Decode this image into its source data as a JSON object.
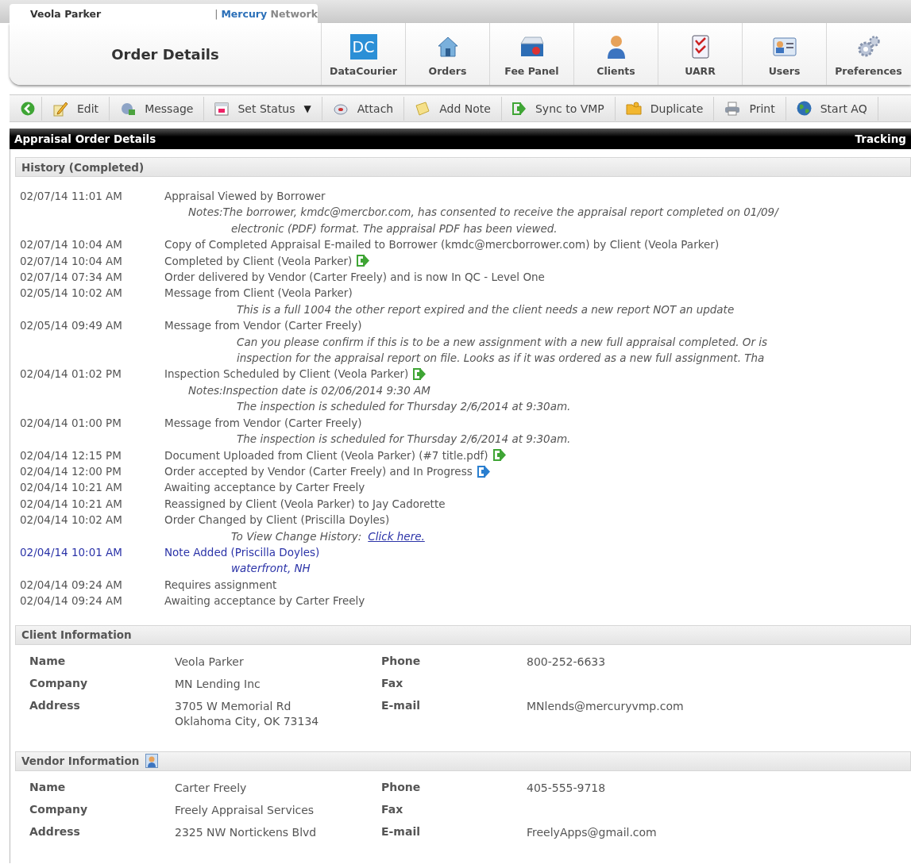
{
  "header": {
    "user_tab": "Veola Parker",
    "separator": "|",
    "brand_first": "Mercury",
    "brand_second": "Network",
    "title": "Order Details",
    "tiles": [
      {
        "label": "DataCourier",
        "icon_text": "DC"
      },
      {
        "label": "Orders"
      },
      {
        "label": "Fee Panel"
      },
      {
        "label": "Clients"
      },
      {
        "label": "UARR"
      },
      {
        "label": "Users"
      },
      {
        "label": "Preferences"
      }
    ]
  },
  "toolbar": [
    {
      "kind": "icon"
    },
    {
      "kind": "labeled",
      "label": "Edit"
    },
    {
      "kind": "labeled",
      "label": "Message"
    },
    {
      "kind": "labeled",
      "label": "Set Status",
      "caret": "▼"
    },
    {
      "kind": "labeled",
      "label": "Attach"
    },
    {
      "kind": "labeled",
      "label": "Add Note"
    },
    {
      "kind": "labeled",
      "label": "Sync to VMP"
    },
    {
      "kind": "labeled",
      "label": "Duplicate"
    },
    {
      "kind": "labeled",
      "label": "Print"
    },
    {
      "kind": "labeled",
      "label": "Start AQ"
    }
  ],
  "section_bar": {
    "title": "Appraisal Order Details",
    "right": "Tracking"
  },
  "history": {
    "title": "History (Completed)",
    "entries": [
      {
        "time": "02/07/14 11:01 AM",
        "text": "Appraisal Viewed by Borrower",
        "highlighted": false,
        "notes": [
          {
            "kind": "notes",
            "text": "Notes:The borrower, kmdc@mercbor.com, has consented to receive the appraisal report completed on 01/09/"
          },
          {
            "kind": "detail",
            "text": "electronic (PDF) format. The appraisal PDF has been viewed."
          }
        ]
      },
      {
        "time": "02/07/14 10:04 AM",
        "text": "Copy of Completed Appraisal E-mailed to Borrower (kmdc@mercborrower.com) by Client (Veola Parker)",
        "highlighted": false
      },
      {
        "time": "02/07/14 10:04 AM",
        "text": "Completed by Client (Veola Parker)",
        "action_icon": {
          "color": "#3fa535"
        },
        "highlighted": false
      },
      {
        "time": "02/07/14 07:34 AM",
        "text": "Order delivered by Vendor (Carter Freely) and is now In QC - Level One",
        "highlighted": false
      },
      {
        "time": "02/05/14 10:02 AM",
        "text": "Message from Client (Veola Parker)",
        "highlighted": false,
        "notes": [
          {
            "kind": "message",
            "text": "This is a full 1004 the other report expired and the client needs a new report NOT an update"
          }
        ]
      },
      {
        "time": "02/05/14 09:49 AM",
        "text": "Message from Vendor (Carter Freely)",
        "highlighted": false,
        "notes": [
          {
            "kind": "message",
            "text": "Can you please confirm if this is to be a new assignment with a new full appraisal completed. Or is"
          },
          {
            "kind": "message",
            "text": "inspection for the appraisal report on file. Looks as if it was ordered as a new full assignment. Tha"
          }
        ]
      },
      {
        "time": "02/04/14 01:02 PM",
        "text": "Inspection Scheduled by Client (Veola Parker)",
        "action_icon": {
          "color": "#3fa535"
        },
        "highlighted": false,
        "notes": [
          {
            "kind": "notes",
            "text": "Notes:Inspection date is 02/06/2014 9:30 AM"
          },
          {
            "kind": "message",
            "text": "The inspection is scheduled for Thursday 2/6/2014 at 9:30am."
          }
        ]
      },
      {
        "time": "02/04/14 01:00 PM",
        "text": "Message from Vendor (Carter Freely)",
        "highlighted": false,
        "notes": [
          {
            "kind": "message",
            "text": "The inspection is scheduled for Thursday 2/6/2014 at 9:30am."
          }
        ]
      },
      {
        "time": "02/04/14 12:15 PM",
        "text": "Document Uploaded from Client (Veola Parker) (#7 title.pdf)",
        "action_icon": {
          "color": "#3fa535"
        },
        "highlighted": false
      },
      {
        "time": "02/04/14 12:00 PM",
        "text": "Order accepted by Vendor (Carter Freely) and In Progress",
        "action_icon": {
          "color": "#2a7fd0"
        },
        "highlighted": false
      },
      {
        "time": "02/04/14 10:21 AM",
        "text": "Awaiting acceptance by Carter Freely",
        "highlighted": false
      },
      {
        "time": "02/04/14 10:21 AM",
        "text": "Reassigned by Client (Veola Parker) to Jay Cadorette",
        "highlighted": false
      },
      {
        "time": "02/04/14 10:02 AM",
        "text": "Order Changed by Client (Priscilla Doyles)",
        "highlighted": false,
        "notes": [
          {
            "kind": "detail",
            "text": "To View Change History:",
            "link": "Click here."
          }
        ]
      },
      {
        "time": "02/04/14 10:01 AM",
        "text": "Note Added (Priscilla Doyles)",
        "highlighted": true,
        "notes": [
          {
            "kind": "detail",
            "text": "waterfront, NH"
          }
        ]
      },
      {
        "time": "02/04/14 09:24 AM",
        "text": "Requires assignment",
        "highlighted": false
      },
      {
        "time": "02/04/14 09:24 AM",
        "text": "Awaiting acceptance by Carter Freely",
        "highlighted": false
      }
    ]
  },
  "client_info": {
    "title": "Client Information",
    "rows": [
      {
        "label": "Name",
        "value": "Veola Parker",
        "label_2": "Phone",
        "value_2": "800-252-6633"
      },
      {
        "label": "Company",
        "value": "MN Lending Inc",
        "label_2": "Fax"
      },
      {
        "label": "Address",
        "value": "3705 W Memorial Rd",
        "value_line_2": "Oklahoma City, OK 73134",
        "label_2": "E-mail",
        "value_2": "MNlends@mercuryvmp.com"
      }
    ]
  },
  "vendor_info": {
    "title": "Vendor Information",
    "rows": [
      {
        "label": "Name",
        "value": "Carter Freely",
        "label_2": "Phone",
        "value_2": "405-555-9718"
      },
      {
        "label": "Company",
        "value": "Freely Appraisal Services",
        "label_2": "Fax"
      },
      {
        "label": "Address",
        "value": "2325 NW Nortickens Blvd",
        "label_2": "E-mail",
        "value_2": "FreelyApps@gmail.com"
      }
    ]
  }
}
